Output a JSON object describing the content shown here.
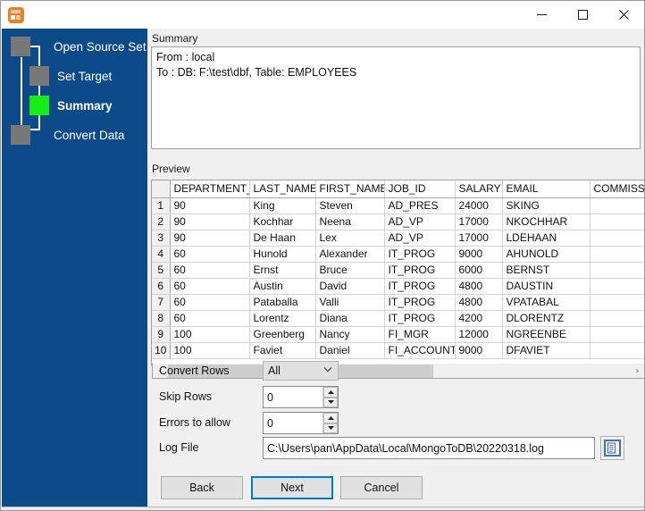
{
  "window": {
    "title": "",
    "icon": "app-icon",
    "minimize_label": "—",
    "maximize_label": "□",
    "close_label": "✕"
  },
  "sidebar": {
    "background_color": "#0d4a8a",
    "active_color": "#16ed16",
    "inactive_color": "#787878",
    "steps": [
      {
        "label": "Open Source Set",
        "state": "inactive"
      },
      {
        "label": "Set Target",
        "state": "inactive"
      },
      {
        "label": "Summary",
        "state": "active"
      },
      {
        "label": "Convert Data",
        "state": "inactive"
      }
    ]
  },
  "summary": {
    "group_label": "Summary",
    "line1": "From : local",
    "line2": "To : DB: F:\\test\\dbf, Table: EMPLOYEES"
  },
  "preview": {
    "group_label": "Preview",
    "columns": [
      "",
      "DEPARTMENT_",
      "LAST_NAME",
      "FIRST_NAME",
      "JOB_ID",
      "SALARY",
      "EMAIL",
      "COMMISS"
    ],
    "rows": [
      [
        "1",
        "90",
        "King",
        "Steven",
        "AD_PRES",
        "24000",
        "SKING",
        ""
      ],
      [
        "2",
        "90",
        "Kochhar",
        "Neena",
        "AD_VP",
        "17000",
        "NKOCHHAR",
        ""
      ],
      [
        "3",
        "90",
        "De Haan",
        "Lex",
        "AD_VP",
        "17000",
        "LDEHAAN",
        ""
      ],
      [
        "4",
        "60",
        "Hunold",
        "Alexander",
        "IT_PROG",
        "9000",
        "AHUNOLD",
        ""
      ],
      [
        "5",
        "60",
        "Ernst",
        "Bruce",
        "IT_PROG",
        "6000",
        "BERNST",
        ""
      ],
      [
        "6",
        "60",
        "Austin",
        "David",
        "IT_PROG",
        "4800",
        "DAUSTIN",
        ""
      ],
      [
        "7",
        "60",
        "Pataballa",
        "Valli",
        "IT_PROG",
        "4800",
        "VPATABAL",
        ""
      ],
      [
        "8",
        "60",
        "Lorentz",
        "Diana",
        "IT_PROG",
        "4200",
        "DLORENTZ",
        ""
      ],
      [
        "9",
        "100",
        "Greenberg",
        "Nancy",
        "FI_MGR",
        "12000",
        "NGREENBE",
        ""
      ],
      [
        "10",
        "100",
        "Faviet",
        "Daniel",
        "FI_ACCOUNT",
        "9000",
        "DFAVIET",
        ""
      ]
    ],
    "scroll_left_arrow": "‹",
    "scroll_right_arrow": "›"
  },
  "form": {
    "convert_rows_label": "Convert Rows",
    "convert_rows_value": "All",
    "convert_rows_arrow": "⌄",
    "skip_rows_label": "Skip Rows",
    "skip_rows_value": "0",
    "errors_label": "Errors to allow",
    "errors_value": "0",
    "log_file_label": "Log File",
    "log_file_value": "C:\\Users\\pan\\AppData\\Local\\MongoToDB\\20220318.log",
    "log_file_browse_icon": "document-icon",
    "spin_up": "▲",
    "spin_down": "▼"
  },
  "buttons": {
    "back": "Back",
    "next": "Next",
    "cancel": "Cancel",
    "accent_color": "#0078d7"
  }
}
